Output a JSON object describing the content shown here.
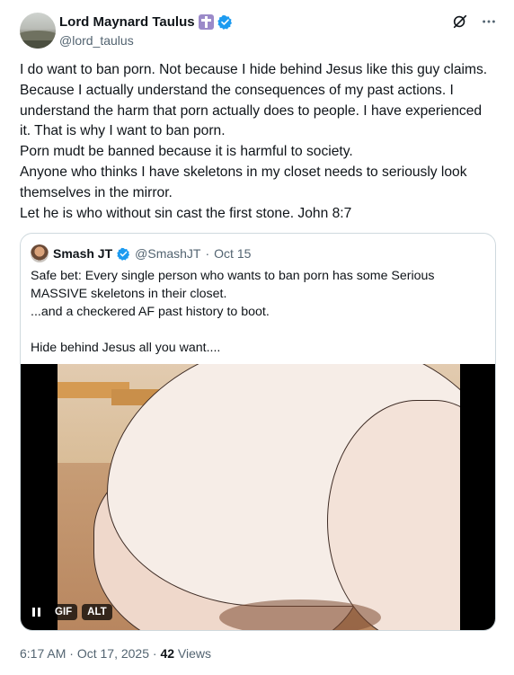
{
  "author": {
    "display_name": "Lord Maynard Taulus",
    "handle": "@lord_taulus"
  },
  "tweet": {
    "lines": [
      "I do want to ban porn. Not because I hide behind Jesus like this guy claims. Because I actually understand the consequences of my past actions. I understand the harm that porn actually does to people. I have experienced it. That is why I want to ban porn.",
      "Porn mudt be banned because it is harmful to society.",
      "Anyone who thinks I have skeletons in my closet needs to seriously look themselves in the mirror.",
      "Let he is who without sin cast the first stone. John 8:7"
    ]
  },
  "quote": {
    "display_name": "Smash JT",
    "handle": "@SmashJT",
    "separator": "·",
    "date": "Oct 15",
    "lines": [
      "Safe bet: Every single person who wants to ban porn has some Serious MASSIVE skeletons in their closet.",
      "...and a checkered AF past history to boot.",
      "",
      "Hide behind Jesus all you want...."
    ],
    "media": {
      "gif_label": "GIF",
      "alt_label": "ALT"
    }
  },
  "meta": {
    "time": "6:17 AM",
    "separator": "·",
    "date": "Oct 17, 2025",
    "views_count": "42",
    "views_label": "Views"
  },
  "icons": {
    "badge": "cross-badge-icon",
    "verified": "verified-check-icon",
    "grok": "grok-icon",
    "more": "more-icon",
    "pause": "pause-icon"
  },
  "colors": {
    "verified_blue": "#1d9bf0",
    "secondary_text": "#536471",
    "primary_text": "#0f1419",
    "badge_purple": "#9b8ac9"
  }
}
